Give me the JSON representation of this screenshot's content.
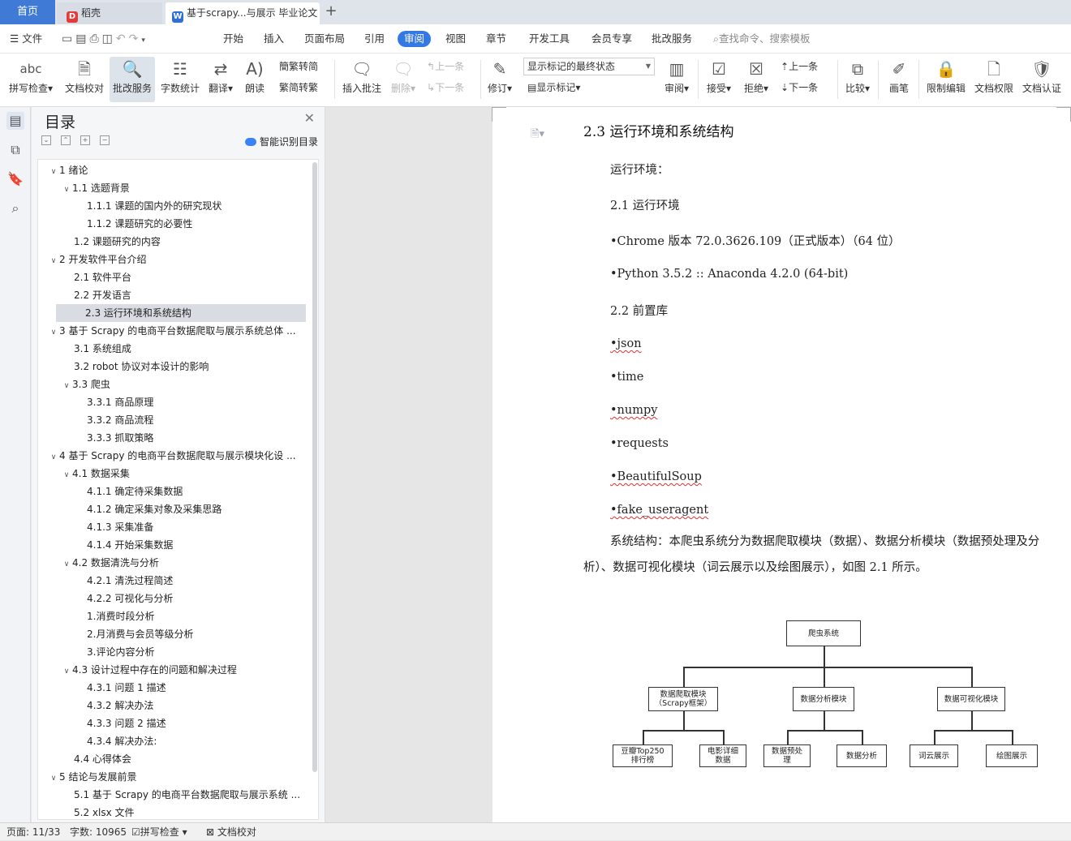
{
  "tabs": {
    "home": "首页",
    "daoke": "稻壳",
    "doc": "基于scrapy...与展示 毕业论文",
    "plus": "+"
  },
  "menu": {
    "file": "文件",
    "items": [
      "开始",
      "插入",
      "页面布局",
      "引用",
      "审阅",
      "视图",
      "章节",
      "开发工具",
      "会员专享",
      "批改服务"
    ],
    "active_index": 4,
    "search": "查找命令、搜索模板"
  },
  "ribbon": {
    "spell": "拼写检查",
    "proof": "文档校对",
    "revise": "批改服务",
    "wordcount": "字数统计",
    "translate": "翻译",
    "read": "朗读",
    "t2s": "繁转简",
    "s2t": "简转繁",
    "insert_comment": "插入批注",
    "delete": "删除",
    "prev": "上一条",
    "next": "下一条",
    "track": "修订",
    "markup_state": "显示标记的最终状态",
    "show_markup": "显示标记",
    "review": "审阅",
    "accept": "接受",
    "reject": "拒绝",
    "prev2": "上一条",
    "next2": "下一条",
    "compare": "比较",
    "pen": "画笔",
    "restrict": "限制编辑",
    "perm": "文档权限",
    "cert": "文档认证"
  },
  "toc": {
    "title": "目录",
    "smart": "智能识别目录",
    "items": [
      {
        "label": "1  绪论",
        "level": 0,
        "chev": "v"
      },
      {
        "label": "1.1  选题背景",
        "level": 1,
        "chev": "v"
      },
      {
        "label": "1.1.1  课题的国内外的研究现状",
        "level": 2,
        "chev": ""
      },
      {
        "label": "1.1.2  课题研究的必要性",
        "level": 2,
        "chev": ""
      },
      {
        "label": "1.2  课题研究的内容",
        "level": 1,
        "chev": ""
      },
      {
        "label": "2  开发软件平台介绍",
        "level": 0,
        "chev": "v"
      },
      {
        "label": "2.1  软件平台",
        "level": 1,
        "chev": ""
      },
      {
        "label": "2.2  开发语言",
        "level": 1,
        "chev": ""
      },
      {
        "label": "2.3  运行环境和系统结构",
        "level": 1,
        "chev": "",
        "selected": true
      },
      {
        "label": "3  基于 Scrapy 的电商平台数据爬取与展示系统总体 ...",
        "level": 0,
        "chev": "v"
      },
      {
        "label": "3.1  系统组成",
        "level": 1,
        "chev": ""
      },
      {
        "label": "3.2  robot 协议对本设计的影响",
        "level": 1,
        "chev": ""
      },
      {
        "label": "3.3  爬虫",
        "level": 1,
        "chev": "v"
      },
      {
        "label": "3.3.1  商品原理",
        "level": 2,
        "chev": ""
      },
      {
        "label": "3.3.2  商品流程",
        "level": 2,
        "chev": ""
      },
      {
        "label": "3.3.3  抓取策略",
        "level": 2,
        "chev": ""
      },
      {
        "label": "4  基于 Scrapy 的电商平台数据爬取与展示模块化设 ...",
        "level": 0,
        "chev": "v"
      },
      {
        "label": "4.1 数据采集",
        "level": 1,
        "chev": "v"
      },
      {
        "label": "4.1.1 确定待采集数据",
        "level": 2,
        "chev": ""
      },
      {
        "label": "4.1.2 确定采集对象及采集思路",
        "level": 2,
        "chev": ""
      },
      {
        "label": "4.1.3 采集准备",
        "level": 2,
        "chev": ""
      },
      {
        "label": "4.1.4 开始采集数据",
        "level": 2,
        "chev": ""
      },
      {
        "label": "4.2 数据清洗与分析",
        "level": 1,
        "chev": "v"
      },
      {
        "label": "4.2.1 清洗过程简述",
        "level": 2,
        "chev": ""
      },
      {
        "label": "4.2.2 可视化与分析",
        "level": 2,
        "chev": ""
      },
      {
        "label": "1.消费时段分析",
        "level": 2,
        "chev": ""
      },
      {
        "label": "2.月消费与会员等级分析",
        "level": 2,
        "chev": ""
      },
      {
        "label": "3.评论内容分析",
        "level": 2,
        "chev": ""
      },
      {
        "label": "4.3 设计过程中存在的问题和解决过程",
        "level": 1,
        "chev": "v"
      },
      {
        "label": "4.3.1 问题 1 描述",
        "level": 2,
        "chev": ""
      },
      {
        "label": "4.3.2 解决办法",
        "level": 2,
        "chev": ""
      },
      {
        "label": "4.3.3 问题 2 描述",
        "level": 2,
        "chev": ""
      },
      {
        "label": "4.3.4 解决办法:",
        "level": 2,
        "chev": ""
      },
      {
        "label": "4.4 心得体会",
        "level": 1,
        "chev": ""
      },
      {
        "label": "5  结论与发展前景",
        "level": 0,
        "chev": "v"
      },
      {
        "label": "5.1  基于 Scrapy 的电商平台数据爬取与展示系统 ...",
        "level": 1,
        "chev": ""
      },
      {
        "label": "5.2  xlsx 文件",
        "level": 1,
        "chev": ""
      }
    ]
  },
  "doc": {
    "heading": "2.3  运行环境和系统结构",
    "lines": [
      {
        "text": "运行环境：",
        "squig": false
      },
      {
        "text": "2.1 运行环境",
        "squig": false
      },
      {
        "text": "•Chrome 版本 72.0.3626.109（正式版本）（64 位）",
        "squig": false
      },
      {
        "text": "•Python 3.5.2 :: Anaconda 4.2.0 (64-bit)",
        "squig": false
      },
      {
        "text": "2.2 前置库",
        "squig": false
      },
      {
        "text": "•json",
        "squig": true
      },
      {
        "text": "•time",
        "squig": false
      },
      {
        "text": "•numpy",
        "squig": true
      },
      {
        "text": "•requests",
        "squig": false
      },
      {
        "text": "•BeautifulSoup",
        "squig": true
      },
      {
        "text": "•fake_useragent",
        "squig": true
      }
    ],
    "system_para": "系统结构：本爬虫系统分为数据爬取模块（数据）、数据分析模块（数据预处理及分析）、数据可视化模块（词云展示以及绘图展示），如图 2.1 所示。",
    "figure": {
      "root": "爬虫系统",
      "modules": [
        {
          "label": "数据爬取模块\n（Scrapy框架）",
          "children": [
            "豆瓣Top250\n排行榜",
            "电影详细\n数据"
          ]
        },
        {
          "label": "数据分析模块",
          "children": [
            "数据预处\n理",
            "数据分析"
          ]
        },
        {
          "label": "数据可视化模块",
          "children": [
            "词云展示",
            "绘图展示"
          ]
        }
      ]
    }
  },
  "status": {
    "page": "页面: 11/33",
    "words": "字数: 10965",
    "spell": "拼写检查",
    "proof": "文档校对"
  }
}
